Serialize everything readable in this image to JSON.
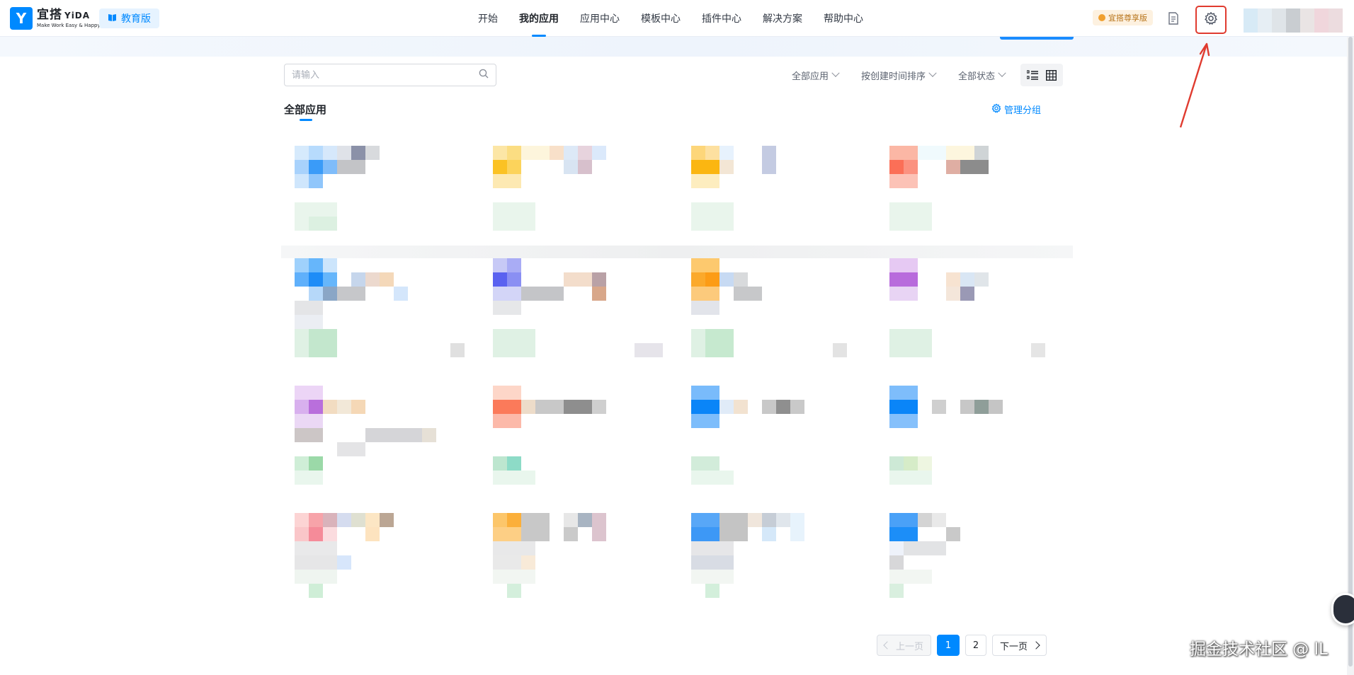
{
  "brand": {
    "logo_glyph": "Y",
    "name": "宜搭",
    "name_suffix": "YiDA",
    "slogan": "Make Work Easy & Happy",
    "edition_badge": "教育版"
  },
  "nav": {
    "items": [
      {
        "label": "开始",
        "active": false
      },
      {
        "label": "我的应用",
        "active": true
      },
      {
        "label": "应用中心",
        "active": false
      },
      {
        "label": "模板中心",
        "active": false
      },
      {
        "label": "插件中心",
        "active": false
      },
      {
        "label": "解决方案",
        "active": false
      },
      {
        "label": "帮助中心",
        "active": false
      }
    ]
  },
  "header_right": {
    "premium_label": "宜搭尊享版",
    "settings_icon": "gear-icon",
    "highlight_color": "#e03b2f"
  },
  "toolbar": {
    "search_placeholder": "请输入",
    "filters": [
      "全部应用",
      "按创建时间排序",
      "全部状态"
    ],
    "view_modes": [
      "list-view-icon",
      "grid-view-icon"
    ]
  },
  "section": {
    "title": "全部应用",
    "manage_group_label": "管理分组"
  },
  "pagination": {
    "prev_label": "上一页",
    "pages": [
      "1",
      "2"
    ],
    "current_page": "1",
    "next_label": "下一页"
  },
  "watermark": "掘金技术社区 @ lL",
  "colors": {
    "accent": "#0089ff",
    "annotation_red": "#e03b2f"
  }
}
